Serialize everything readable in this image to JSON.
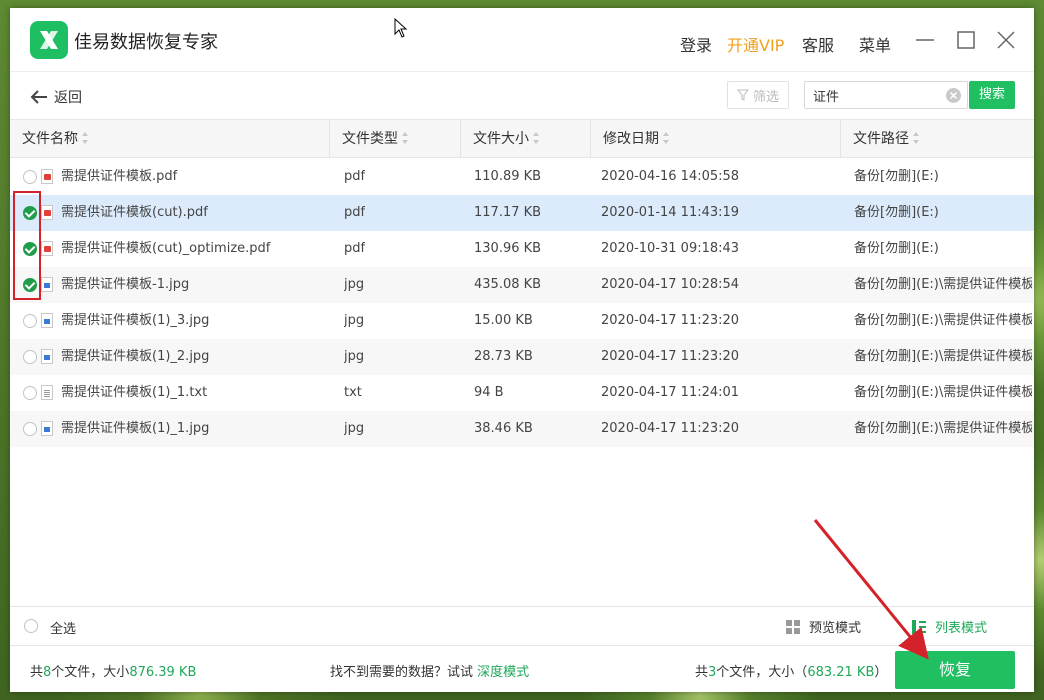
{
  "app": {
    "title": "佳易数据恢复专家",
    "nav": {
      "login": "登录",
      "vip": "开通VIP",
      "service": "客服",
      "menu": "菜单"
    }
  },
  "toolbar": {
    "back_label": "返回",
    "filter_label": "筛选",
    "search_value": "证件",
    "search_button": "搜索"
  },
  "table": {
    "headers": [
      "文件名称",
      "文件类型",
      "文件大小",
      "修改日期",
      "文件路径"
    ],
    "rows": [
      {
        "checked": false,
        "icon": "pdf-file-icon",
        "name": "需提供证件模板.pdf",
        "type": "pdf",
        "size": "110.89 KB",
        "date": "2020-04-16 14:05:58",
        "path": "备份[勿删](E:)"
      },
      {
        "checked": true,
        "icon": "pdf-file-icon",
        "name": "需提供证件模板(cut).pdf",
        "type": "pdf",
        "size": "117.17 KB",
        "date": "2020-01-14 11:43:19",
        "path": "备份[勿删](E:)"
      },
      {
        "checked": true,
        "icon": "pdf-file-icon",
        "name": "需提供证件模板(cut)_optimize.pdf",
        "type": "pdf",
        "size": "130.96 KB",
        "date": "2020-10-31 09:18:43",
        "path": "备份[勿删](E:)"
      },
      {
        "checked": true,
        "icon": "image-file-icon",
        "name": "需提供证件模板-1.jpg",
        "type": "jpg",
        "size": "435.08 KB",
        "date": "2020-04-17 10:28:54",
        "path": "备份[勿删](E:)\\需提供证件模板"
      },
      {
        "checked": false,
        "icon": "image-file-icon",
        "name": "需提供证件模板(1)_3.jpg",
        "type": "jpg",
        "size": "15.00 KB",
        "date": "2020-04-17 11:23:20",
        "path": "备份[勿删](E:)\\需提供证件模板("
      },
      {
        "checked": false,
        "icon": "image-file-icon",
        "name": "需提供证件模板(1)_2.jpg",
        "type": "jpg",
        "size": "28.73 KB",
        "date": "2020-04-17 11:23:20",
        "path": "备份[勿删](E:)\\需提供证件模板("
      },
      {
        "checked": false,
        "icon": "text-file-icon",
        "name": "需提供证件模板(1)_1.txt",
        "type": "txt",
        "size": "94 B",
        "date": "2020-04-17 11:24:01",
        "path": "备份[勿删](E:)\\需提供证件模板("
      },
      {
        "checked": false,
        "icon": "image-file-icon",
        "name": "需提供证件模板(1)_1.jpg",
        "type": "jpg",
        "size": "38.46 KB",
        "date": "2020-04-17 11:23:20",
        "path": "备份[勿删](E:)\\需提供证件模板("
      }
    ]
  },
  "selection": {
    "select_all": "全选",
    "preview_mode": "预览模式",
    "list_mode": "列表模式"
  },
  "status": {
    "total_prefix": "共",
    "total_count": "8",
    "total_mid": "个文件，大小",
    "total_size": "876.39 KB",
    "not_found_text": "找不到需要的数据？试试",
    "deep_mode": "深度模式",
    "selected_prefix": "共",
    "selected_count": "3",
    "selected_mid": "个文件，大小（",
    "selected_size": "683.21 KB",
    "selected_suffix": "）",
    "restore_button": "恢复"
  },
  "colors": {
    "accent": "#1fbf62",
    "vip": "#f0a020",
    "annotation": "#d4222a"
  }
}
